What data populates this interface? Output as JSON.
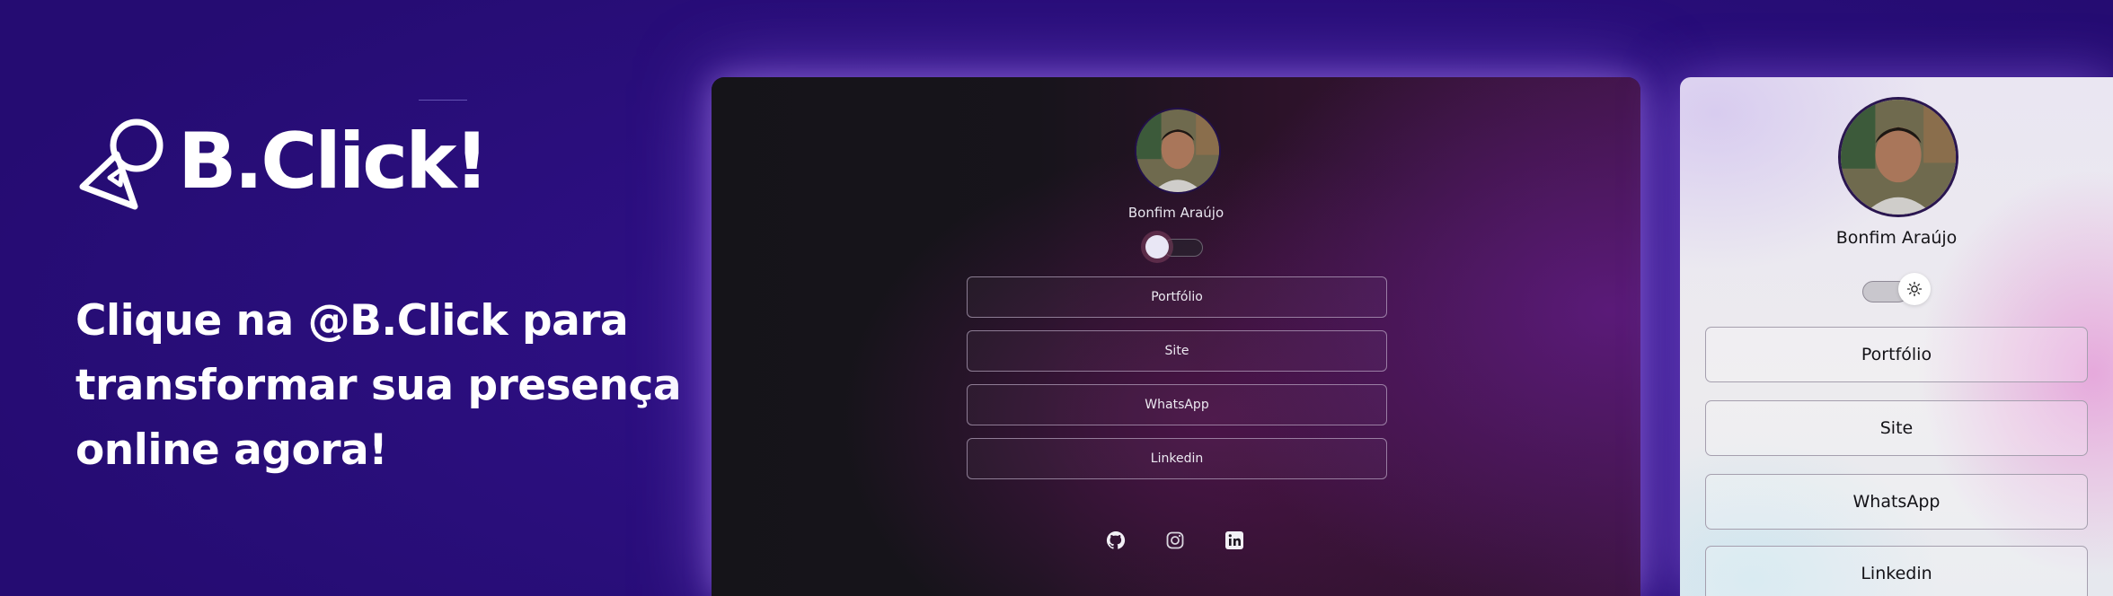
{
  "brand": {
    "name": "B.Click!"
  },
  "headline": {
    "lines": [
      "Clique na @B.Click para",
      "transformar sua presença",
      "online agora!"
    ]
  },
  "preview_dark": {
    "profile_name": "Bonfim Araújo",
    "theme_toggle": "dark",
    "links": [
      "Portfólio",
      "Site",
      "WhatsApp",
      "Linkedin"
    ],
    "social_icons": [
      "github-icon",
      "instagram-icon",
      "linkedin-icon"
    ]
  },
  "preview_light": {
    "profile_name": "Bonfim Araújo",
    "theme_toggle": "light",
    "links": [
      "Portfólio",
      "Site",
      "WhatsApp",
      "Linkedin"
    ]
  },
  "colors": {
    "background": "#2c0f80",
    "brand_text": "#ffffff",
    "dark_card": "#17141b",
    "light_card": "#ecebee"
  }
}
